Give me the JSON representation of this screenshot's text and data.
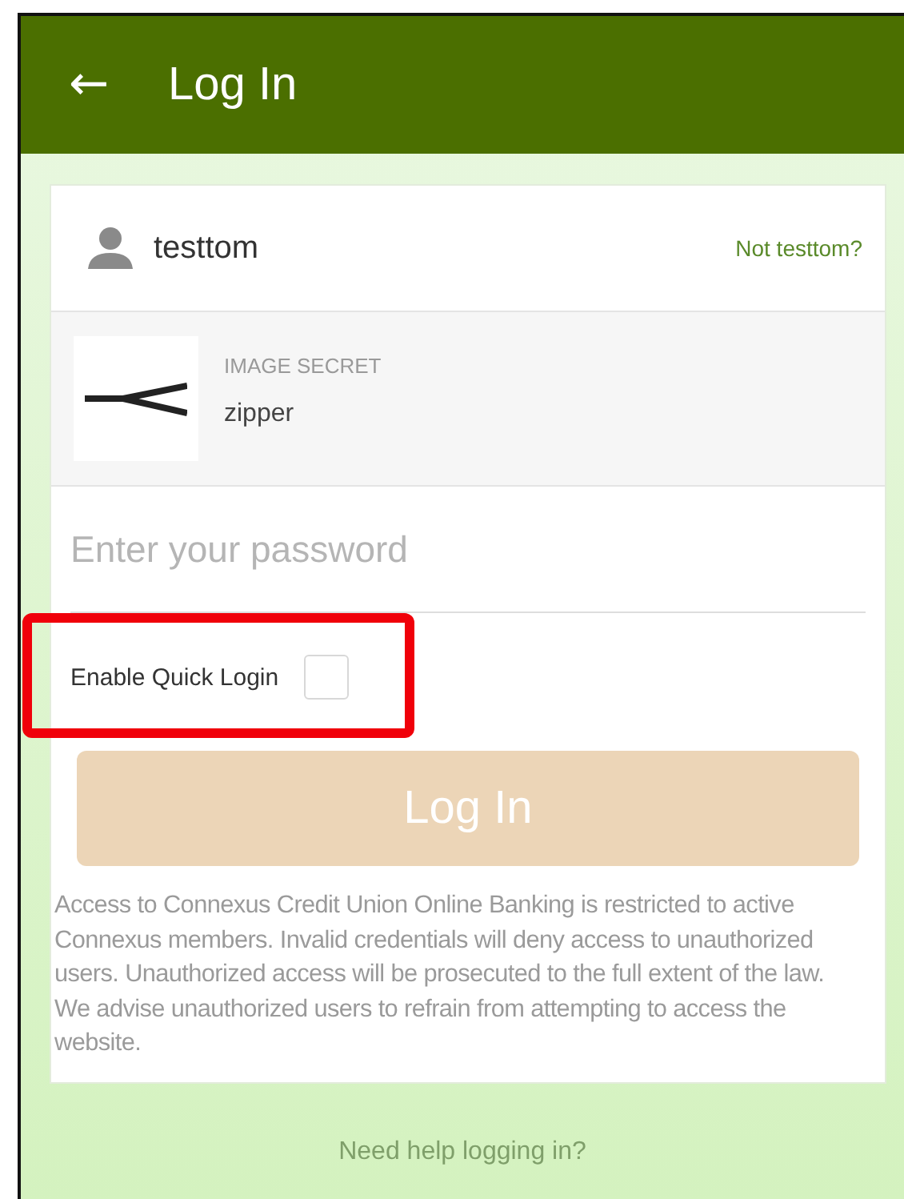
{
  "header": {
    "back_icon": "←",
    "title": "Log In"
  },
  "user": {
    "name": "testtom",
    "switch_link": "Not testtom?"
  },
  "image_secret": {
    "label": "IMAGE SECRET",
    "value": "zipper"
  },
  "password": {
    "placeholder": "Enter your password"
  },
  "quick_login": {
    "label": "Enable Quick Login",
    "checked": false,
    "highlighted": true
  },
  "login_button": {
    "label": "Log In",
    "disabled": true
  },
  "disclaimer": "Access to Connexus Credit Union Online Banking is restricted to active Connexus members. Invalid credentials will deny access to unauthorized users. Unauthorized access will be prosecuted to the full extent of the law. We advise unauthorized users to refrain from attempting to access the website.",
  "help_link": "Need help logging in?"
}
